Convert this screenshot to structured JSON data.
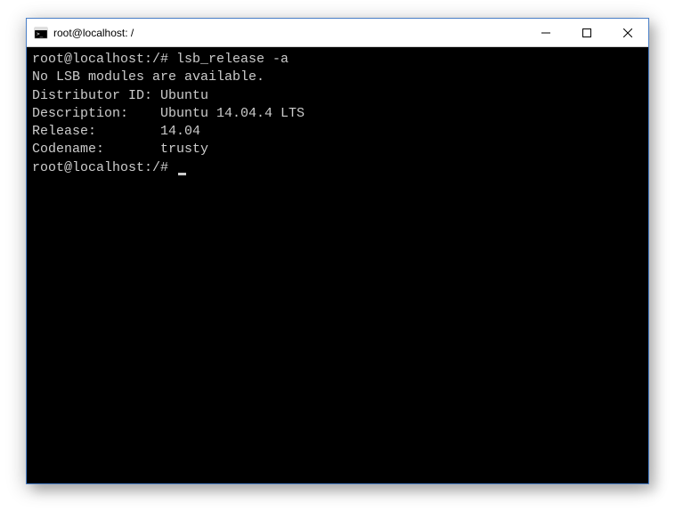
{
  "window": {
    "title": "root@localhost: /"
  },
  "terminal": {
    "lines": [
      "root@localhost:/# lsb_release -a",
      "No LSB modules are available.",
      "Distributor ID: Ubuntu",
      "Description:    Ubuntu 14.04.4 LTS",
      "Release:        14.04",
      "Codename:       trusty"
    ],
    "prompt": "root@localhost:/# "
  }
}
